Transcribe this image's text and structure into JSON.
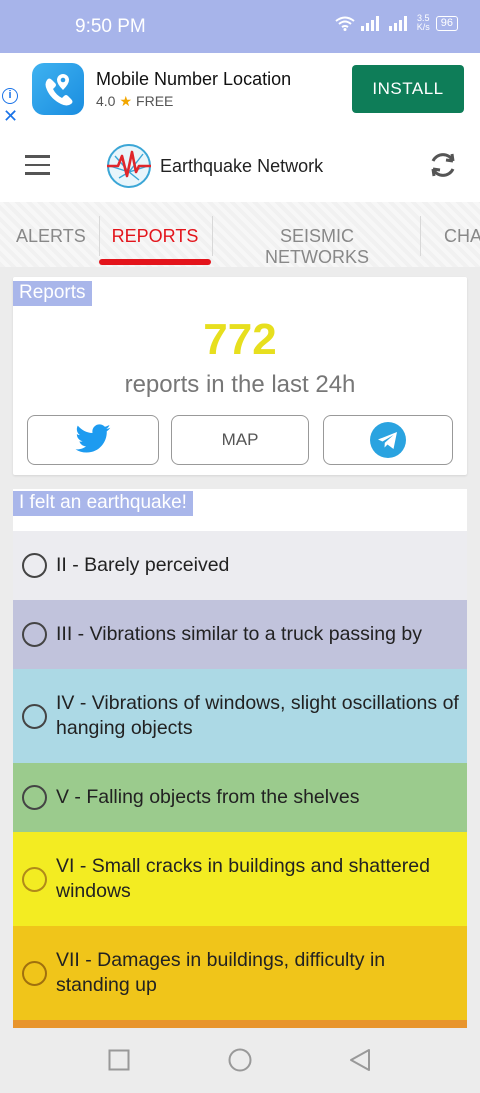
{
  "status_bar": {
    "time": "9:50 PM",
    "speed_value": "3.5",
    "speed_unit": "K/s",
    "battery": "96"
  },
  "ad": {
    "app_name": "Mobile Number Location",
    "rating": "4.0",
    "price": "FREE",
    "install_label": "INSTALL",
    "info_icon": "info-icon",
    "close_icon": "close-icon"
  },
  "app_bar": {
    "title": "Earthquake Network",
    "menu_icon": "hamburger-menu-icon",
    "refresh_icon": "refresh-icon"
  },
  "tabs": [
    {
      "label": "ALERTS",
      "active": false
    },
    {
      "label": "REPORTS",
      "active": true
    },
    {
      "label": "SEISMIC NETWORKS",
      "active": false
    },
    {
      "label": "CHA",
      "active": false
    }
  ],
  "reports_card": {
    "label": "Reports",
    "count": "772",
    "caption": "reports in the last 24h",
    "buttons": {
      "twitter_icon": "twitter-icon",
      "map_label": "MAP",
      "telegram_icon": "telegram-icon"
    }
  },
  "felt_card": {
    "label": "I felt an earthquake!",
    "options": [
      {
        "text": "II - Barely perceived",
        "color": "#ececf0"
      },
      {
        "text": "III - Vibrations similar to a truck passing by",
        "color": "#c1c3dc"
      },
      {
        "text": "IV - Vibrations of windows, slight oscillations of hanging objects",
        "color": "#acd9e5"
      },
      {
        "text": "V - Falling objects from the shelves",
        "color": "#9bcb8d"
      },
      {
        "text": "VI - Small cracks in buildings and shattered windows",
        "color": "#f3ec22"
      },
      {
        "text": "VII - Damages in buildings, difficulty in standing up",
        "color": "#f0c51a"
      }
    ]
  },
  "colors": {
    "status_bar": "#a7b4ea",
    "install": "#0e7d58",
    "tab_active": "#e3141b",
    "count": "#e7df1e"
  },
  "nav_bar": {
    "recents_icon": "square-recents-icon",
    "home_icon": "circle-home-icon",
    "back_icon": "triangle-back-icon"
  }
}
